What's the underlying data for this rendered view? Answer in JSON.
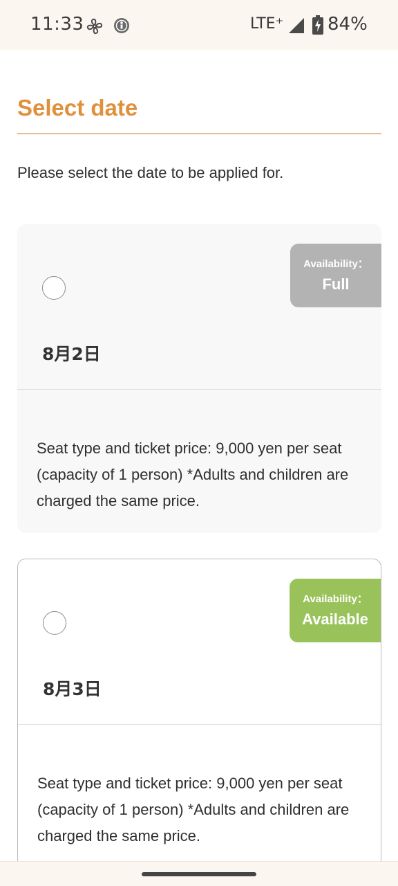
{
  "status_bar": {
    "time": "11:33",
    "network": "LTE⁺",
    "battery": "84%",
    "icons": [
      "fan-icon",
      "accessibility-badge-icon",
      "signal-icon",
      "battery-charging-icon"
    ]
  },
  "page": {
    "title": "Select date",
    "instruction": "Please select the date to be applied for.",
    "accent_color": "#e0903a"
  },
  "dates": [
    {
      "date": "8月2日",
      "availability_label": "Availability：",
      "availability": "Full",
      "availability_color": "#b3b3b3",
      "selected": false,
      "description": "Seat type and ticket price: 9,000 yen per seat (capacity of 1 person) *Adults and children are charged the same price."
    },
    {
      "date": "8月3日",
      "availability_label": "Availability：",
      "availability": "Available",
      "availability_color": "#99c35a",
      "selected": false,
      "description": "Seat type and ticket price: 9,000 yen per seat (capacity of 1 person) *Adults and children are charged the same price."
    }
  ]
}
